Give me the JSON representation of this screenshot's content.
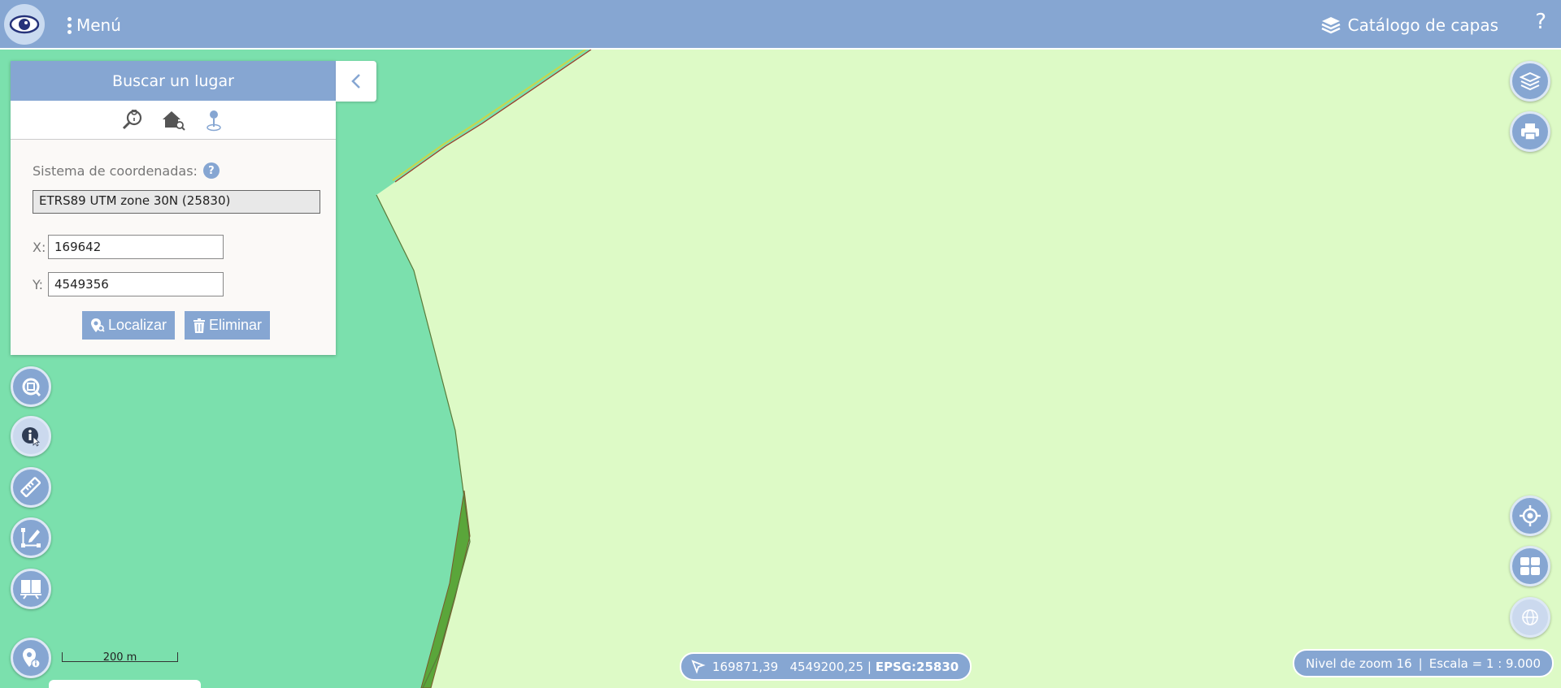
{
  "topbar": {
    "menu_label": "Menú",
    "catalog_label": "Catálogo de capas",
    "help_label": "?"
  },
  "search_panel": {
    "title": "Buscar un lugar",
    "tabs": [
      "search-place-icon",
      "search-address-icon",
      "coordinate-pin-icon"
    ],
    "crs_label": "Sistema de coordenadas:",
    "crs_value": "ETRS89 UTM zone 30N (25830)",
    "x_label": "X:",
    "x_value": "169642",
    "y_label": "Y:",
    "y_value": "4549356",
    "locate_label": "Localizar",
    "delete_label": "Eliminar"
  },
  "scale_bar": {
    "label": "200 m"
  },
  "coordinates": {
    "x": "169871,39",
    "y": "4549200,25",
    "epsg": "EPSG:25830"
  },
  "zoom_info": {
    "zoom_text": "Nivel de zoom 16",
    "scale_text": "Escala = 1 : 9.000"
  },
  "left_tools": [
    "zoom-extent-icon",
    "info-icon",
    "ruler-icon",
    "draw-tool-icon",
    "presentation-icon",
    "geolocation-info-icon"
  ],
  "right_tools": [
    "layers-icon",
    "print-icon",
    "locate-me-icon",
    "basemap-icon",
    "globe-icon"
  ],
  "colors": {
    "accent": "#86a6d2",
    "map_land": "#ddfac6",
    "map_green": "#7be0ad",
    "map_dark_green": "#5aa63a"
  }
}
